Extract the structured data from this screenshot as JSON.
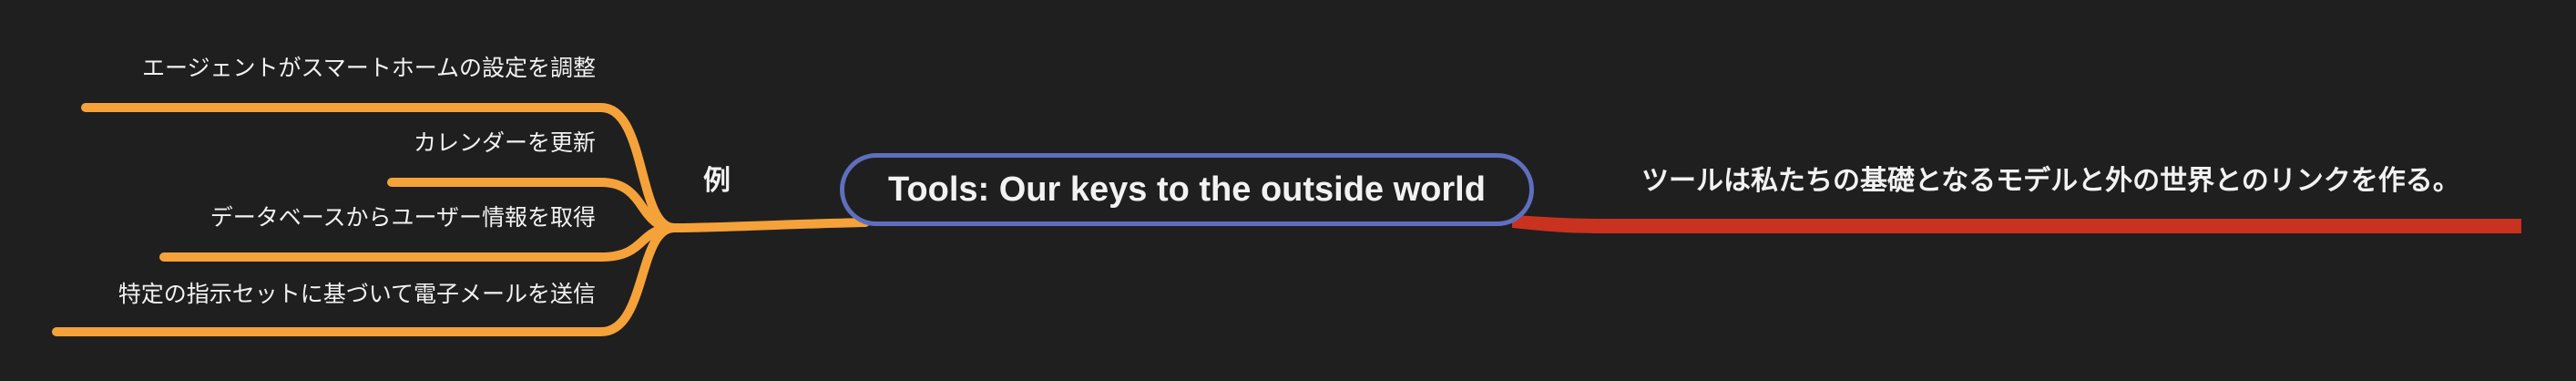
{
  "mindmap": {
    "root": {
      "title": "Tools: Our keys to the outside world"
    },
    "left_branch": {
      "label": "例",
      "color": "#f5a23a",
      "leaves": [
        "エージェントがスマートホームの設定を調整",
        "カレンダーを更新",
        "データベースからユーザー情報を取得",
        "特定の指示セットに基づいて電子メールを送信"
      ]
    },
    "right_branch": {
      "label": "ツールは私たちの基礎となるモデルと外の世界とのリンクを作る。",
      "color": "#c8321e"
    },
    "root_border_color": "#5f6fbe"
  }
}
